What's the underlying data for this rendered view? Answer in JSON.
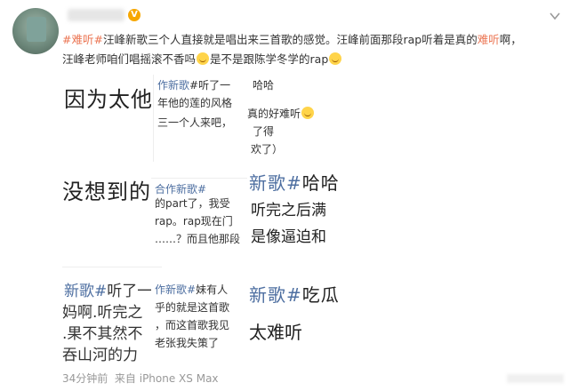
{
  "post": {
    "line1_tag1": "#难听#",
    "line1_text1": "汪峰新歌三个人直接就是唱出来三首歌的感觉。汪峰前面那段rap听着是真的",
    "line1_tag2": "难听",
    "line1_text2": "啊，",
    "line2_text1": "汪峰老师咱们唱摇滚不香吗",
    "line2_text2": "是不是跟陈学冬学的rap",
    "emoji_name": "laughing-with-tears-emoji"
  },
  "collage": {
    "c1": {
      "big": "因为太他"
    },
    "c2": {
      "tag": "作新歌",
      "text1": "#听了一",
      "l2": "年他的莲的风格",
      "l3": "三一个人来吧，",
      "r1": "哈哈",
      "r2": "真的好难听",
      "r3": "了得",
      "r4": "欢了）"
    },
    "c3": {
      "big": "没想到的"
    },
    "c4": {
      "tag": "合作新歌#",
      "l2": "的part了，我受",
      "l3": "rap。rap现在门",
      "l4": "……？而且他那段"
    },
    "c5": {
      "tag": "新歌#",
      "text": "哈哈",
      "l2": "听完之后满",
      "l3": "是像逼迫和"
    },
    "c6": {
      "tag": "新歌#",
      "l1": "听了一",
      "l2": "妈啊.听完之",
      "l3": ".果不其然不",
      "l4": "吞山河的力"
    },
    "c7": {
      "tag": "作新歌#",
      "l1": "妹有人",
      "l2": "乎的就是这首歌",
      "l3": "，而这首歌我见",
      "l4": "老张我失策了"
    },
    "c8": {
      "tag": "新歌#",
      "text": "吃瓜",
      "l2": "太难听"
    }
  },
  "footer": {
    "time": "34分钟前",
    "source": "来自 iPhone XS Max"
  }
}
